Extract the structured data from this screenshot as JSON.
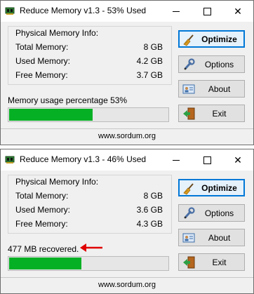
{
  "colors": {
    "progress_fill": "#06b025",
    "progress_track": "#e6e6e6",
    "default_button_border": "#0078d7",
    "annotation_arrow": "#e00000"
  },
  "windows": [
    {
      "title": "Reduce Memory v1.3 - 53% Used",
      "group_title": "Physical Memory Info:",
      "rows": [
        {
          "label": "Total Memory:",
          "value": "8 GB"
        },
        {
          "label": "Used Memory:",
          "value": "4.2 GB"
        },
        {
          "label": "Free Memory:",
          "value": "3.7 GB"
        }
      ],
      "status_text": "Memory usage percentage 53%",
      "progress_percent": 53,
      "buttons": {
        "optimize": "Optimize",
        "options": "Options",
        "about": "About",
        "exit": "Exit"
      },
      "icons": {
        "optimize": "broom-icon",
        "options": "wrench-icon",
        "about": "id-card-icon",
        "exit": "exit-door-icon"
      },
      "footer": "www.sordum.org"
    },
    {
      "title": "Reduce Memory v1.3 - 46% Used",
      "group_title": "Physical Memory Info:",
      "rows": [
        {
          "label": "Total Memory:",
          "value": "8 GB"
        },
        {
          "label": "Used Memory:",
          "value": "3.6 GB"
        },
        {
          "label": "Free Memory:",
          "value": "4.3 GB"
        }
      ],
      "status_text": "477 MB recovered.",
      "progress_percent": 46,
      "buttons": {
        "optimize": "Optimize",
        "options": "Options",
        "about": "About",
        "exit": "Exit"
      },
      "icons": {
        "optimize": "broom-icon",
        "options": "wrench-icon",
        "about": "id-card-icon",
        "exit": "exit-door-icon"
      },
      "footer": "www.sordum.org",
      "annotation": "red-arrow-icon"
    }
  ]
}
